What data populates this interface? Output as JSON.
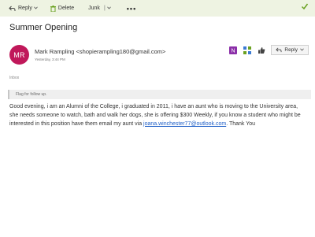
{
  "toolbar": {
    "reply_label": "Reply",
    "delete_label": "Delete",
    "junk_label": "Junk",
    "junk_separator": "|",
    "more_label": "•••"
  },
  "message": {
    "subject": "Summer Opening",
    "avatar_initials": "MR",
    "sender": "Mark Rampling <shopierampling180@gmail.com>",
    "date": "Yesterday, 3:44 PM",
    "folder": "Inbox",
    "flag_text": "Flag for follow up.",
    "reply_label": "Reply",
    "body_before_link": "Good evening, i am an Alumni of the College, i graduated in 2011, i have an aunt who is moving to the University area, she needs someone to watch, bath and walk her dogs, she is offering $300 Weekly, if you know a student who might be interested in this position have them email my aunt via ",
    "body_link": "joana.winchester77@outlook.com",
    "body_after_link": ". Thank You"
  },
  "icons": [
    "reply-icon",
    "trash-icon",
    "chevron-down-icon",
    "check-icon",
    "onenote-icon",
    "apps-icon",
    "like-icon"
  ],
  "colors": {
    "toolbar_bg": "#eef3e2",
    "accent_green": "#6aa121",
    "avatar_bg": "#c0185a",
    "link": "#1f5fc7"
  }
}
